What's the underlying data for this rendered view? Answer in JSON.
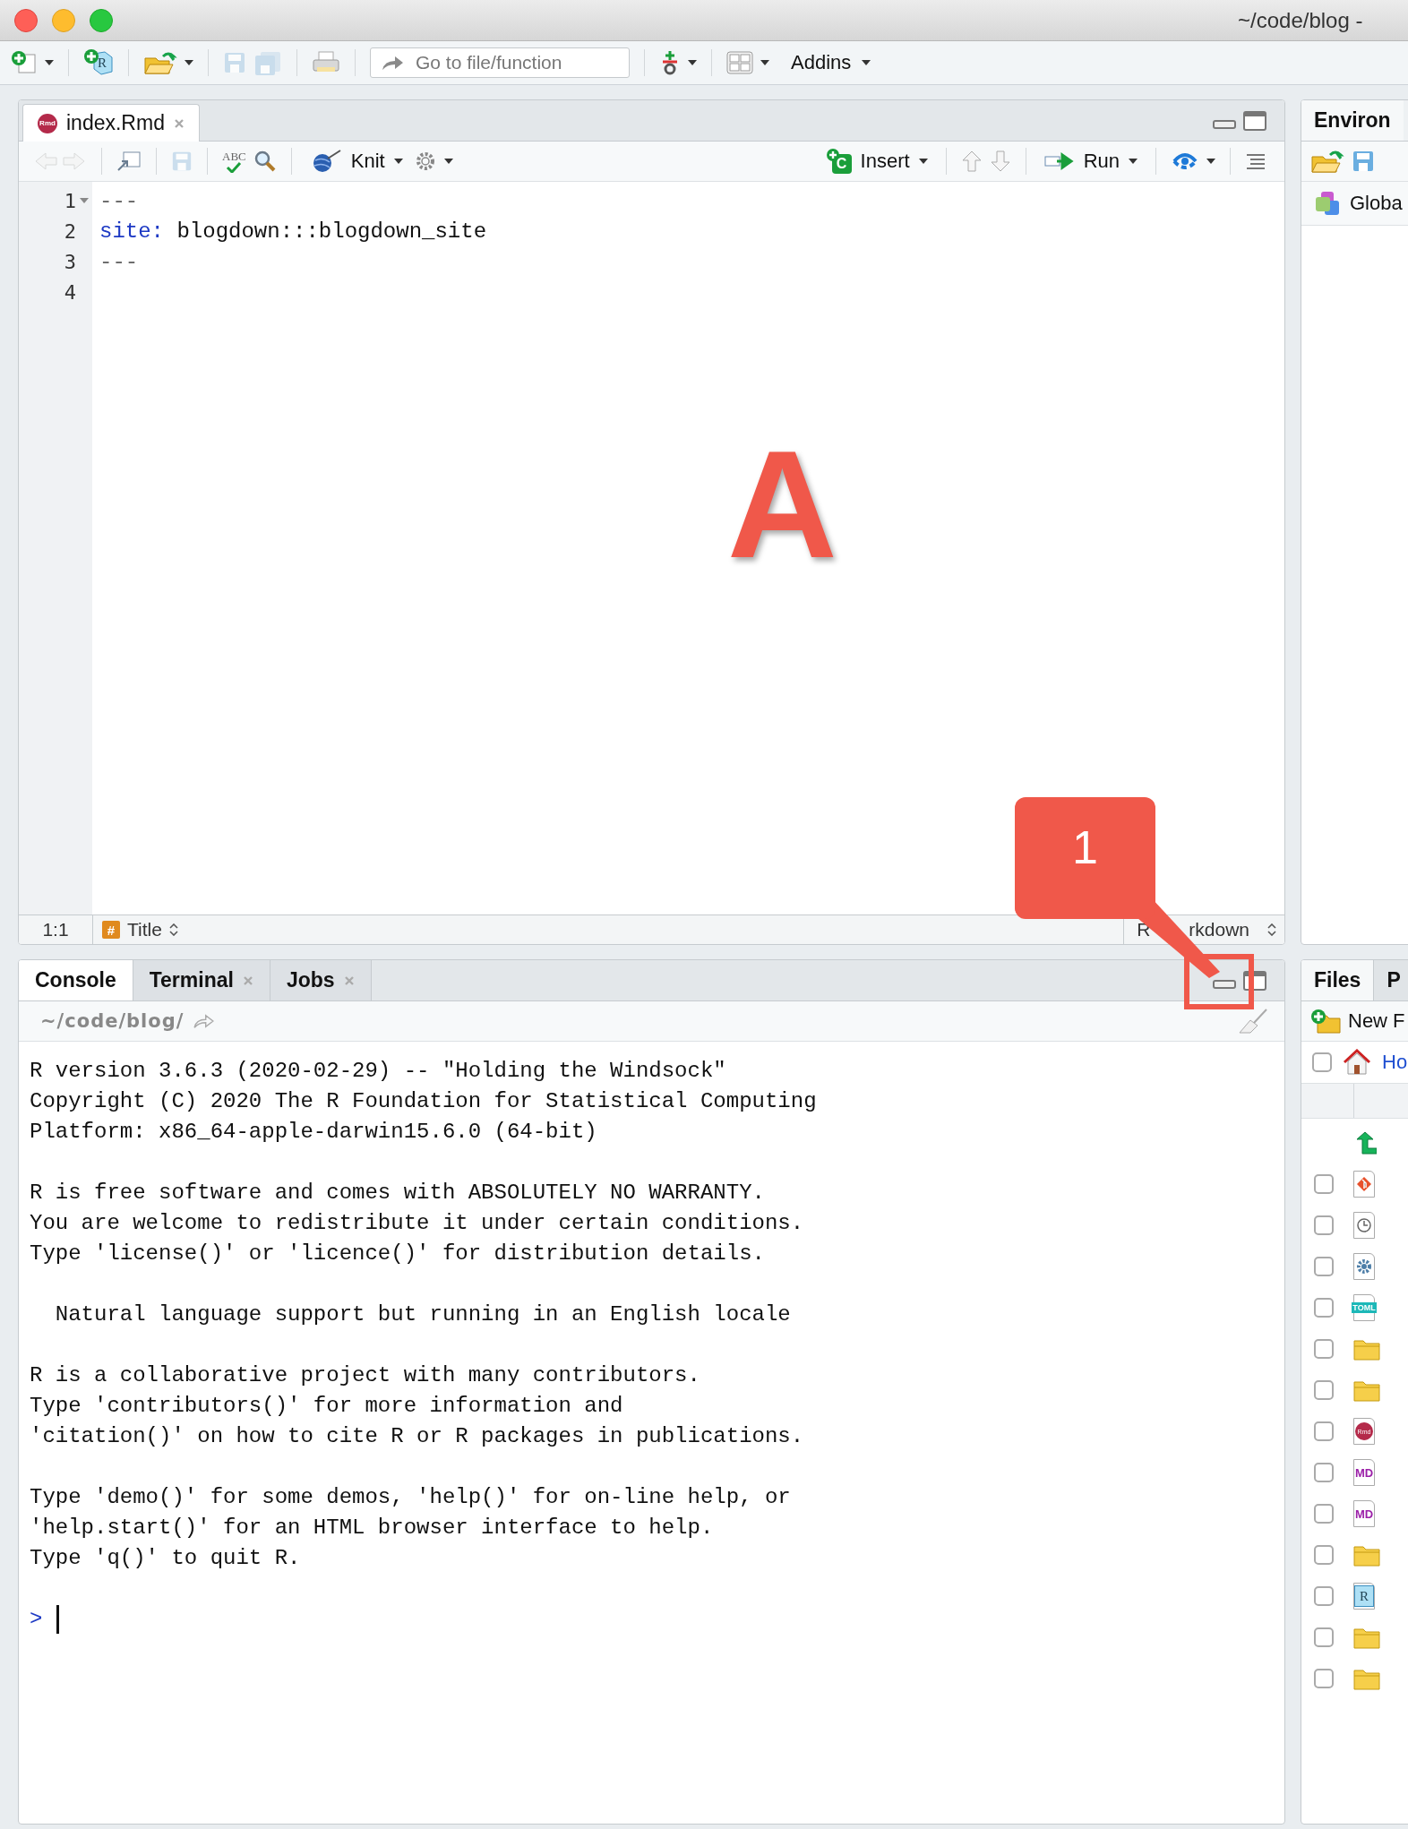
{
  "window": {
    "title": "~/code/blog -"
  },
  "main_toolbar": {
    "project_icon_text": "R",
    "goto_placeholder": "Go to file/function",
    "addins": "Addins"
  },
  "editor": {
    "tabs": [
      {
        "label": "index.Rmd",
        "badge": "Rmd",
        "selected": true
      }
    ],
    "toolbar": {
      "spell_icon_text": "ABC",
      "knit": "Knit",
      "insert_icon_text": "C",
      "insert": "Insert",
      "run": "Run"
    },
    "lines": [
      {
        "number": "1",
        "fold": true,
        "tokens": [
          {
            "kind": "delim",
            "text": "---"
          }
        ]
      },
      {
        "number": "2",
        "fold": false,
        "tokens": [
          {
            "kind": "key",
            "text": "site:"
          },
          {
            "kind": "plain",
            "text": " blogdown:::blogdown_site"
          }
        ]
      },
      {
        "number": "3",
        "fold": false,
        "tokens": [
          {
            "kind": "delim",
            "text": "---"
          }
        ]
      },
      {
        "number": "4",
        "fold": false
      }
    ],
    "status": {
      "position": "1:1",
      "section_icon_text": "#",
      "section": "Title",
      "mode_start": "R",
      "mode_end": "rkdown"
    }
  },
  "console": {
    "tabs": [
      {
        "label": "Console",
        "selected": true,
        "closable": false
      },
      {
        "label": "Terminal",
        "selected": false,
        "closable": true
      },
      {
        "label": "Jobs",
        "selected": false,
        "closable": true
      }
    ],
    "path": "~/code/blog/",
    "blocks": [
      [
        "R version 3.6.3 (2020-02-29) -- \"Holding the Windsock\"",
        "Copyright (C) 2020 The R Foundation for Statistical Computing",
        "Platform: x86_64-apple-darwin15.6.0 (64-bit)"
      ],
      [
        "R is free software and comes with ABSOLUTELY NO WARRANTY.",
        "You are welcome to redistribute it under certain conditions.",
        "Type 'license()' or 'licence()' for distribution details."
      ],
      [
        "  Natural language support but running in an English locale"
      ],
      [
        "R is a collaborative project with many contributors.",
        "Type 'contributors()' for more information and",
        "'citation()' on how to cite R or R packages in publications."
      ],
      [
        "Type 'demo()' for some demos, 'help()' for on-line help, or",
        "'help.start()' for an HTML browser interface to help.",
        "Type 'q()' to quit R."
      ]
    ],
    "prompt": ">"
  },
  "environment": {
    "tab": "Environ",
    "scope": "Globa"
  },
  "files": {
    "tabs": [
      {
        "label": "Files",
        "selected": true
      },
      {
        "label": "P",
        "selected": false
      }
    ],
    "new_folder": "New F",
    "select_all_checked": false,
    "home": "Ho",
    "rows": [
      {
        "kind": "up"
      },
      {
        "kind": "git",
        "checked": false
      },
      {
        "kind": "history",
        "checked": false
      },
      {
        "kind": "settings",
        "checked": false
      },
      {
        "kind": "badge",
        "badge": "TOML",
        "color": "#1cb8b8",
        "checked": false
      },
      {
        "kind": "folder",
        "checked": false
      },
      {
        "kind": "folder",
        "checked": false
      },
      {
        "kind": "rmd",
        "badge": "Rmd",
        "checked": false
      },
      {
        "kind": "badge",
        "badge": "MD",
        "color": "#9b1fa8",
        "checked": false
      },
      {
        "kind": "badge",
        "badge": "MD",
        "color": "#9b1fa8",
        "checked": false
      },
      {
        "kind": "folder",
        "checked": false
      },
      {
        "kind": "rproj",
        "badge": "R",
        "checked": false
      },
      {
        "kind": "folder",
        "checked": false
      },
      {
        "kind": "folder",
        "checked": false
      }
    ]
  },
  "annotations": [
    {
      "kind": "letter",
      "text": "A"
    },
    {
      "kind": "callout",
      "text": "1"
    }
  ]
}
